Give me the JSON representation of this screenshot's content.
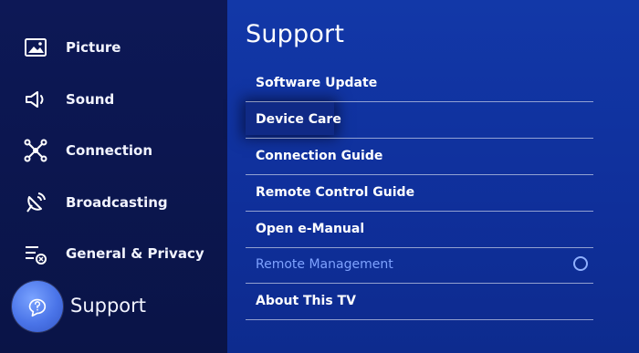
{
  "sidebar": {
    "items": [
      {
        "label": "Picture",
        "icon": "picture-icon"
      },
      {
        "label": "Sound",
        "icon": "speaker-icon"
      },
      {
        "label": "Connection",
        "icon": "connection-icon"
      },
      {
        "label": "Broadcasting",
        "icon": "satellite-dish-icon"
      },
      {
        "label": "General & Privacy",
        "icon": "general-privacy-icon"
      },
      {
        "label": "Support",
        "icon": "support-bubble-icon",
        "active": true
      }
    ]
  },
  "main": {
    "title": "Support",
    "menu": [
      {
        "label": "Software Update"
      },
      {
        "label": "Device Care",
        "focused": true
      },
      {
        "label": "Connection Guide"
      },
      {
        "label": "Remote Control Guide"
      },
      {
        "label": "Open e-Manual"
      },
      {
        "label": "Remote Management",
        "disabled": true,
        "toggle": "off"
      },
      {
        "label": "About This TV"
      }
    ]
  },
  "colors": {
    "sidebar_bg": "#0a1447",
    "main_bg": "#1238a8",
    "disabled_text": "#7ea2ff",
    "active_bubble": "#4a74e8"
  }
}
